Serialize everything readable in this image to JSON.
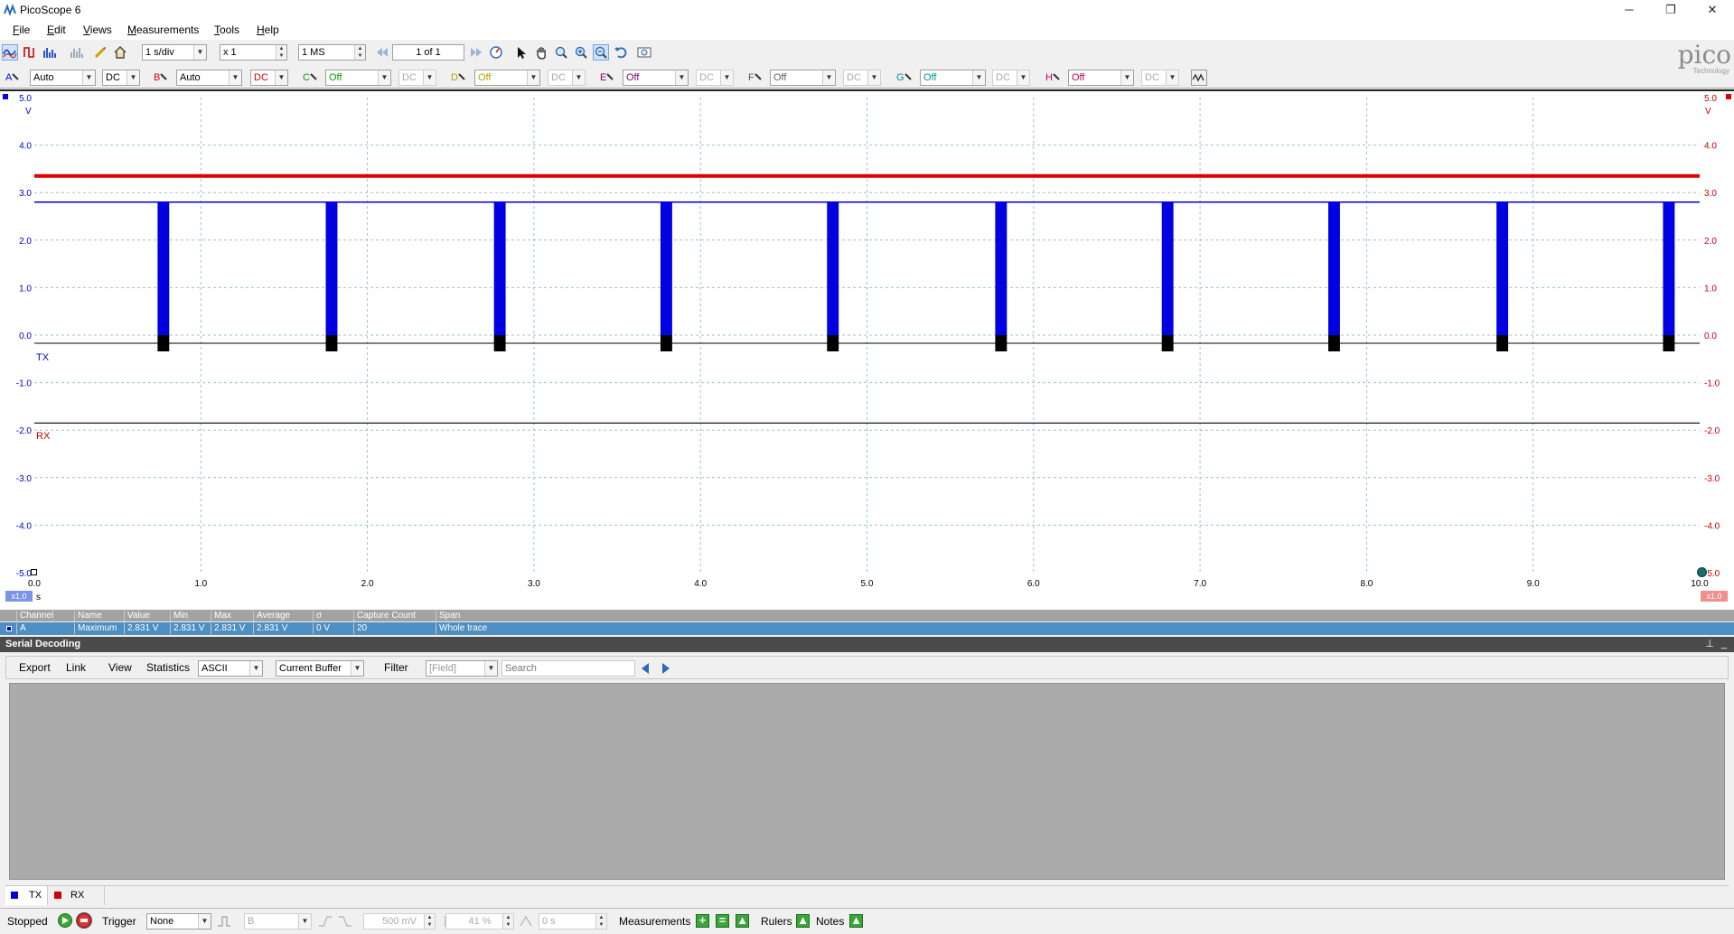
{
  "window": {
    "title": "PicoScope 6",
    "minimize": "─",
    "restore": "❐",
    "close": "✕"
  },
  "menu": [
    "File",
    "Edit",
    "Views",
    "Measurements",
    "Tools",
    "Help"
  ],
  "toolbar1": {
    "timebase": "1 s/div",
    "zoom": "x 1",
    "samples": "1 MS",
    "buffer_pos": "1 of 1"
  },
  "channels": [
    {
      "letter": "A",
      "range": "Auto",
      "coupling": "DC",
      "color": "#0000e0"
    },
    {
      "letter": "B",
      "range": "Auto",
      "coupling": "DC",
      "color": "#e00000"
    },
    {
      "letter": "C",
      "range": "Off",
      "coupling": "DC",
      "color": "#00a000"
    },
    {
      "letter": "D",
      "range": "Off",
      "coupling": "DC",
      "color": "#b8a000"
    },
    {
      "letter": "E",
      "range": "Off",
      "coupling": "DC",
      "color": "#7a007a"
    },
    {
      "letter": "F",
      "range": "Off",
      "coupling": "DC",
      "color": "#606060"
    },
    {
      "letter": "G",
      "range": "Off",
      "coupling": "DC",
      "color": "#0090a0"
    },
    {
      "letter": "H",
      "range": "Off",
      "coupling": "DC",
      "color": "#c00060"
    }
  ],
  "scope": {
    "y_ticks_left": [
      "5.0",
      "4.0",
      "3.0",
      "2.0",
      "1.0",
      "0.0",
      "-1.0",
      "-2.0",
      "-3.0",
      "-4.0",
      "-5.0"
    ],
    "y_ticks_right": [
      "5.0",
      "4.0",
      "3.0",
      "2.0",
      "1.0",
      "0.0",
      "-1.0",
      "-2.0",
      "-3.0",
      "-4.0",
      "-5.0"
    ],
    "y_unit_left": "V",
    "y_unit_right": "V",
    "x_ticks": [
      "0.0",
      "1.0",
      "2.0",
      "3.0",
      "4.0",
      "5.0",
      "6.0",
      "7.0",
      "8.0",
      "9.0",
      "10.0"
    ],
    "x_unit": "s",
    "zoom_left": "x1.0",
    "zoom_right": "x1.0",
    "label_tx": "TX",
    "label_rx": "RX",
    "tx_color": "#0000e0",
    "rx_color": "#e00000"
  },
  "chart_data": {
    "type": "line",
    "xlim": [
      0,
      10
    ],
    "ylim": [
      -5,
      5
    ],
    "grid": true,
    "series": [
      {
        "name": "TX",
        "high_level": 2.8,
        "low_level": 0.0,
        "pulse_starts": [
          0.74,
          1.75,
          2.76,
          3.76,
          4.76,
          5.77,
          6.77,
          7.77,
          8.78,
          9.78
        ],
        "pulse_width": 0.07
      },
      {
        "name": "RX",
        "level": 3.35
      }
    ]
  },
  "measurements": {
    "headers": [
      "Channel",
      "Name",
      "Value",
      "Min",
      "Max",
      "Average",
      "σ",
      "Capture Count",
      "Span"
    ],
    "rows": [
      [
        "A",
        "Maximum",
        "2.831 V",
        "2.831 V",
        "2.831 V",
        "2.831 V",
        "0 V",
        "20",
        "Whole trace"
      ]
    ]
  },
  "serial": {
    "title": "Serial Decoding",
    "buttons": [
      "Export",
      "Link",
      "View",
      "Statistics"
    ],
    "format": "ASCII",
    "buffer": "Current Buffer",
    "filter_label": "Filter",
    "field_placeholder": "[Field]",
    "search_placeholder": "Search",
    "tabs": [
      "TX",
      "RX"
    ]
  },
  "status": {
    "state": "Stopped",
    "trigger_label": "Trigger",
    "trigger_mode": "None",
    "trigger_source": "B",
    "threshold": "500 mV",
    "pretrigger": "41 %",
    "delay": "0 s",
    "measurements_label": "Measurements",
    "rulers_label": "Rulers",
    "notes_label": "Notes"
  },
  "brand": {
    "name": "pico",
    "sub": "Technology"
  }
}
